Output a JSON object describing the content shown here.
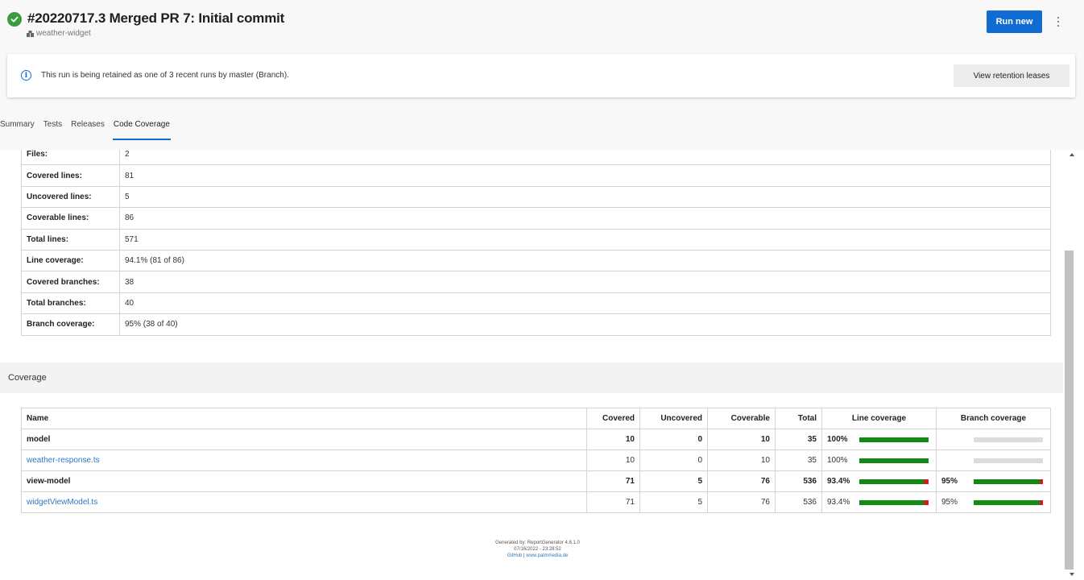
{
  "header": {
    "title": "#20220717.3 Merged PR 7: Initial commit",
    "repo": "weather-widget",
    "run_new_label": "Run new",
    "status_icon": "check-circle-icon",
    "more_icon": "more-vertical-icon"
  },
  "banner": {
    "text": "This run is being retained as one of 3 recent runs by master (Branch).",
    "button_label": "View retention leases",
    "icon": "info-icon"
  },
  "tabs": [
    {
      "label": "Summary",
      "active": false
    },
    {
      "label": "Tests",
      "active": false
    },
    {
      "label": "Releases",
      "active": false
    },
    {
      "label": "Code Coverage",
      "active": true
    }
  ],
  "summary": [
    {
      "key": "Files:",
      "value": "2"
    },
    {
      "key": "Covered lines:",
      "value": "81"
    },
    {
      "key": "Uncovered lines:",
      "value": "5"
    },
    {
      "key": "Coverable lines:",
      "value": "86"
    },
    {
      "key": "Total lines:",
      "value": "571"
    },
    {
      "key": "Line coverage:",
      "value": "94.1% (81 of 86)"
    },
    {
      "key": "Covered branches:",
      "value": "38"
    },
    {
      "key": "Total branches:",
      "value": "40"
    },
    {
      "key": "Branch coverage:",
      "value": "95% (38 of 40)"
    }
  ],
  "coverage": {
    "section_title": "Coverage",
    "columns": [
      "Name",
      "Covered",
      "Uncovered",
      "Coverable",
      "Total",
      "Line coverage",
      "Branch coverage"
    ],
    "rows": [
      {
        "name": "model",
        "type": "group",
        "covered": "10",
        "uncovered": "0",
        "coverable": "10",
        "total": "35",
        "line_pct": "100%",
        "line_fraction": 1.0,
        "branch_pct": "",
        "branch_fraction": null
      },
      {
        "name": "weather-response.ts",
        "type": "file",
        "covered": "10",
        "uncovered": "0",
        "coverable": "10",
        "total": "35",
        "line_pct": "100%",
        "line_fraction": 1.0,
        "branch_pct": "",
        "branch_fraction": null
      },
      {
        "name": "view-model",
        "type": "group",
        "covered": "71",
        "uncovered": "5",
        "coverable": "76",
        "total": "536",
        "line_pct": "93.4%",
        "line_fraction": 0.934,
        "branch_pct": "95%",
        "branch_fraction": 0.95
      },
      {
        "name": "widgetViewModel.ts",
        "type": "file",
        "covered": "71",
        "uncovered": "5",
        "coverable": "76",
        "total": "536",
        "line_pct": "93.4%",
        "line_fraction": 0.934,
        "branch_pct": "95%",
        "branch_fraction": 0.95
      }
    ]
  },
  "footer": {
    "line1": "Generated by: ReportGenerator 4.8.1.0",
    "line2": "07/16/2022 - 23:28:52",
    "link1": "GitHub",
    "separator": " | ",
    "link2": "www.palmmedia.de"
  },
  "colors": {
    "accent": "#0f6cd0",
    "success": "#3b9c3f",
    "covered": "#138a13",
    "uncovered": "#d41c1c",
    "link": "#2c78c4"
  }
}
